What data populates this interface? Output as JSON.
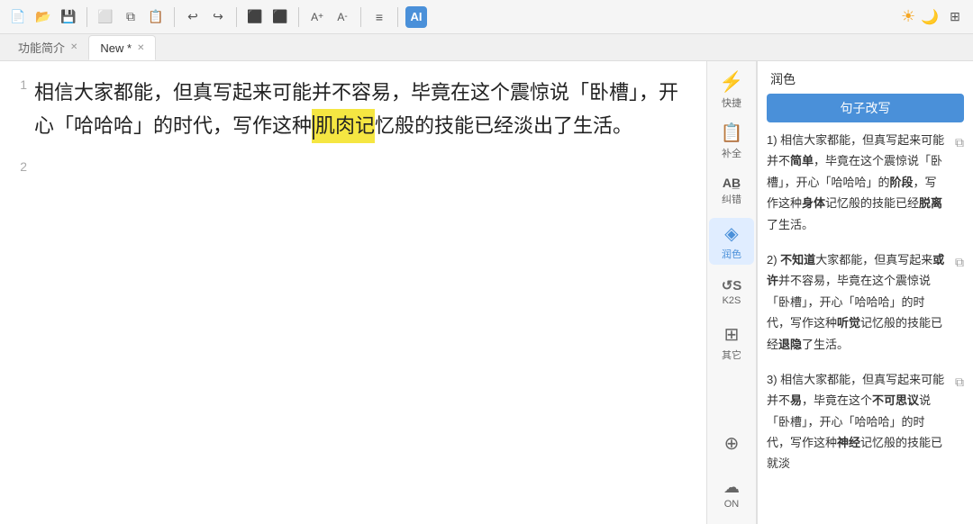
{
  "toolbar": {
    "ai_label": "AI",
    "undo_icon": "↩",
    "redo_icon": "↪"
  },
  "tabs": [
    {
      "id": "tab-intro",
      "label": "功能简介",
      "closable": true,
      "active": false
    },
    {
      "id": "tab-new",
      "label": "New *",
      "closable": true,
      "active": true
    }
  ],
  "document": {
    "lines": [
      {
        "number": "1",
        "text_before": "相信大家都能，但真写起来可能并不容易，毕竟在这个震惊说「卧槽」，开心「哈哈哈」的时代，写作这种",
        "highlight": "肌肉记",
        "text_after": "忆般的技能已经淡出了生活。"
      },
      {
        "number": "2",
        "text_before": "",
        "highlight": "",
        "text_after": ""
      }
    ]
  },
  "sidebar_icons": [
    {
      "id": "run",
      "icon": "▶",
      "label": "润色",
      "unicode": "⚡",
      "active": false
    },
    {
      "id": "shortcut",
      "icon": "⚡",
      "label": "快捷",
      "active": false
    },
    {
      "id": "supplement",
      "icon": "📄",
      "label": "补全",
      "active": false
    },
    {
      "id": "proofread",
      "icon": "AB",
      "label": "纠错",
      "active": false
    },
    {
      "id": "polish",
      "icon": "◆",
      "label": "润色",
      "active": true
    },
    {
      "id": "k2s",
      "icon": "S",
      "label": "K2S",
      "active": false
    },
    {
      "id": "more",
      "icon": "⊞",
      "label": "其它",
      "active": false
    }
  ],
  "sidebar_bottom_icons": [
    {
      "id": "import",
      "icon": "⊕",
      "label": ""
    },
    {
      "id": "cloud",
      "icon": "☁",
      "label": "ON"
    }
  ],
  "right_panel": {
    "title": "润色",
    "tab_label": "句子改写",
    "results": [
      {
        "num": "1)",
        "text": "相信大家都能，但真写起来可能并不",
        "bold_part": "简单",
        "text2": "，毕竟在这个震惊说「卧槽」，开心「哈哈哈」的",
        "bold_part2": "阶段",
        "text3": "，写作这种",
        "bold_part3": "身体",
        "text4": "记忆般的技能已经",
        "bold_part4": "脱离",
        "text5": "了生活。"
      },
      {
        "num": "2)",
        "text": "",
        "bold_part": "不知道",
        "text2": "大家都能，但真写起来",
        "bold_part2": "或许",
        "text3": "并不容易，毕竟在这个震惊说「卧槽」，开心「哈哈哈」的时代，写作这种",
        "bold_part3": "听觉",
        "text4": "记忆般的技能已经",
        "bold_part4": "退隐",
        "text5": "了生活。"
      },
      {
        "num": "3)",
        "text": "相信大家都能，但真写起来可能并不",
        "bold_part": "易",
        "text2": "，毕竟在这个",
        "bold_part2": "不可思议",
        "text3": "说「卧槽」，开心「哈哈哈」的时代，写作这种",
        "bold_part3": "神经",
        "text4": "记忆般的技能已就淡"
      }
    ]
  }
}
